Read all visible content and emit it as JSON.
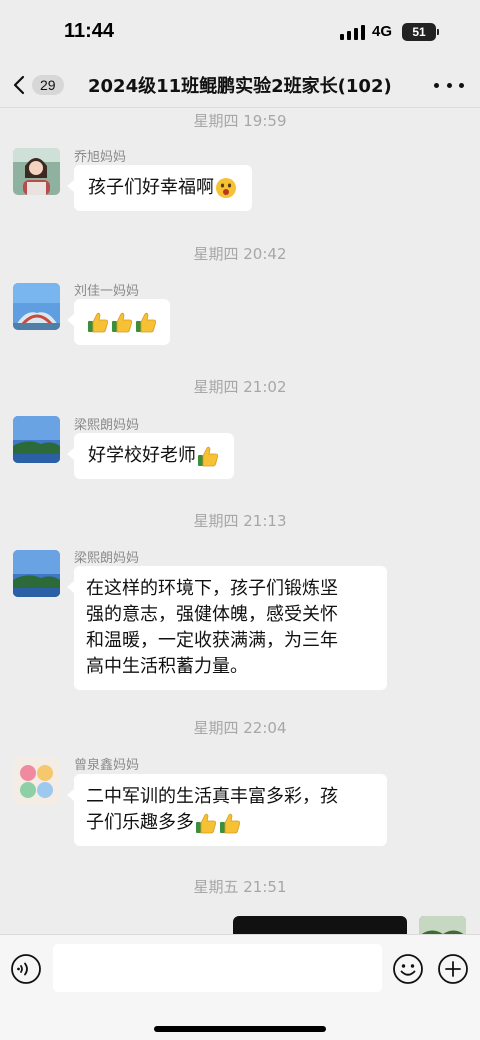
{
  "status_bar": {
    "time": "11:44",
    "network": "4G",
    "battery": "51"
  },
  "header": {
    "back_count": "29",
    "title": "2024级11班鲲鹏实验2班家长(102)"
  },
  "messages": [
    {
      "timestamp": "星期四 19:59",
      "sender": "乔旭妈妈",
      "text": "孩子们好幸福啊",
      "emojis": [
        "surprised-face-emoji"
      ]
    },
    {
      "timestamp": "星期四 20:42",
      "sender": "刘佳一妈妈",
      "text": "",
      "emojis": [
        "thumbs-up-emoji",
        "thumbs-up-emoji",
        "thumbs-up-emoji"
      ]
    },
    {
      "timestamp": "星期四 21:02",
      "sender": "梁熙朗妈妈",
      "text": "好学校好老师",
      "emojis": [
        "thumbs-up-emoji"
      ]
    },
    {
      "timestamp": "星期四 21:13",
      "sender": "梁熙朗妈妈",
      "lines": [
        "在这样的环境下，孩子们锻炼坚",
        "强的意志，强健体魄，感受关怀",
        "和温暖，一定收获满满，为三年",
        "高中生活积蓄力量。"
      ]
    },
    {
      "timestamp": "星期四 22:04",
      "sender": "曾泉鑫妈妈",
      "lines": [
        "二中军训的生活真丰富多彩，孩",
        "子们乐趣多多"
      ],
      "emojis": [
        "thumbs-up-emoji",
        "thumbs-up-emoji"
      ]
    },
    {
      "timestamp": "星期五 21:51"
    }
  ],
  "input": {
    "value": "",
    "placeholder": ""
  },
  "colors": {
    "background": "#ededed",
    "bubble": "#ffffff",
    "timestamp": "#a7a7a7",
    "sender": "#8a8a8a"
  },
  "icons": {
    "back": "chevron-left-icon",
    "more": "more-dots-icon",
    "voice": "voice-icon",
    "emoji": "emoji-face-icon",
    "plus": "plus-icon"
  }
}
